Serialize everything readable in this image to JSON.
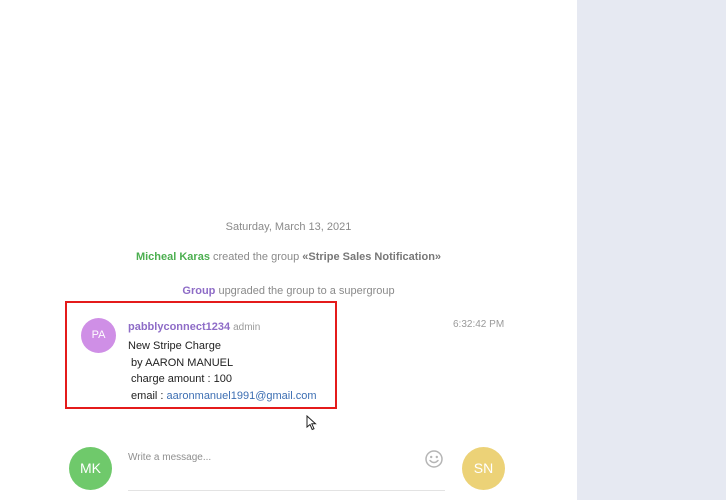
{
  "date_separator": "Saturday, March 13, 2021",
  "service_messages": [
    {
      "actor": "Micheal Karas",
      "text": " created the group ",
      "target": "«Stripe Sales Notification»"
    },
    {
      "actor": "Group",
      "text": " upgraded the group to a supergroup"
    }
  ],
  "message": {
    "avatar_initials": "PA",
    "author": "pabblyconnect1234",
    "role": "admin",
    "time": "6:32:42 PM",
    "lines": {
      "title": "New Stripe Charge",
      "by": " by AARON MANUEL",
      "amount": " charge amount : 100",
      "email_prefix": " email : ",
      "email": "aaronmanuel1991@gmail.com"
    }
  },
  "composer": {
    "placeholder": "Write a message...",
    "left_avatar": "MK",
    "right_avatar": "SN"
  },
  "colors": {
    "highlight_border": "#e41b1b",
    "right_panel": "#e6e9f2",
    "author": "#8e6cc7",
    "link": "#3d6fb3"
  },
  "icons": [
    "emoji-icon",
    "mouse-cursor-icon"
  ]
}
